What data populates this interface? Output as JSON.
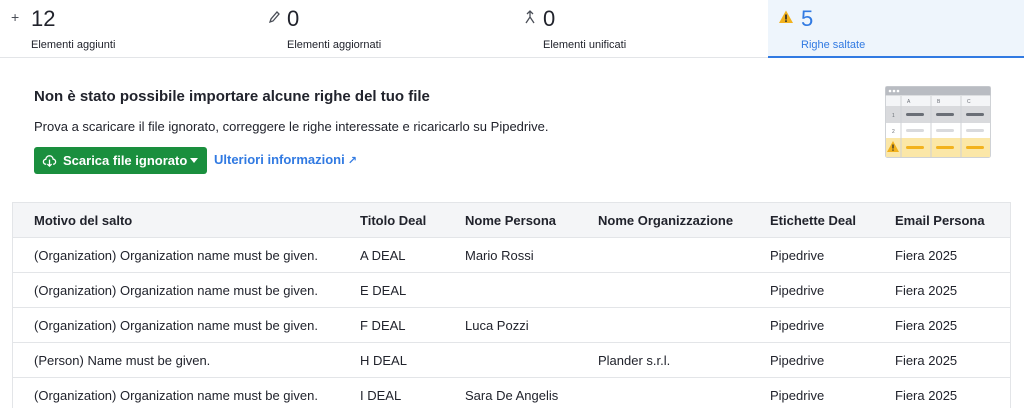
{
  "stats": [
    {
      "icon": "plus-icon",
      "value": "12",
      "label": "Elementi aggiunti",
      "active": false
    },
    {
      "icon": "pencil-icon",
      "value": "0",
      "label": "Elementi aggiornati",
      "active": false
    },
    {
      "icon": "merge-icon",
      "value": "0",
      "label": "Elementi unificati",
      "active": false
    },
    {
      "icon": "warning-icon",
      "value": "5",
      "label": "Righe saltate",
      "active": true
    }
  ],
  "message": {
    "headline": "Non è stato possibile importare alcune righe del tuo file",
    "description": "Prova a scaricare il file ignorato, correggere le righe interessate e ricaricarlo su Pipedrive.",
    "download_label": "Scarica file ignorato",
    "more_info_label": "Ulteriori informazioni"
  },
  "illustration": {
    "columns": [
      "A",
      "B",
      "C"
    ],
    "rows": [
      "1",
      "2"
    ]
  },
  "colors": {
    "accent": "#317ae2",
    "button": "#1a8f3e",
    "warning": "#f2b21d"
  },
  "table": {
    "headers": [
      "Motivo del salto",
      "Titolo Deal",
      "Nome Persona",
      "Nome Organizzazione",
      "Etichette Deal",
      "Email Persona"
    ],
    "rows": [
      [
        "(Organization) Organization name must be given.",
        "A DEAL",
        "Mario Rossi",
        "",
        "Pipedrive",
        "Fiera 2025"
      ],
      [
        "(Organization) Organization name must be given.",
        "E DEAL",
        "",
        "",
        "Pipedrive",
        "Fiera 2025"
      ],
      [
        "(Organization) Organization name must be given.",
        "F DEAL",
        "Luca Pozzi",
        "",
        "Pipedrive",
        "Fiera 2025"
      ],
      [
        "(Person) Name must be given.",
        "H DEAL",
        "",
        "Plander s.r.l.",
        "Pipedrive",
        "Fiera 2025"
      ],
      [
        "(Organization) Organization name must be given.",
        "I DEAL",
        "Sara De Angelis",
        "",
        "Pipedrive",
        "Fiera 2025"
      ]
    ]
  }
}
